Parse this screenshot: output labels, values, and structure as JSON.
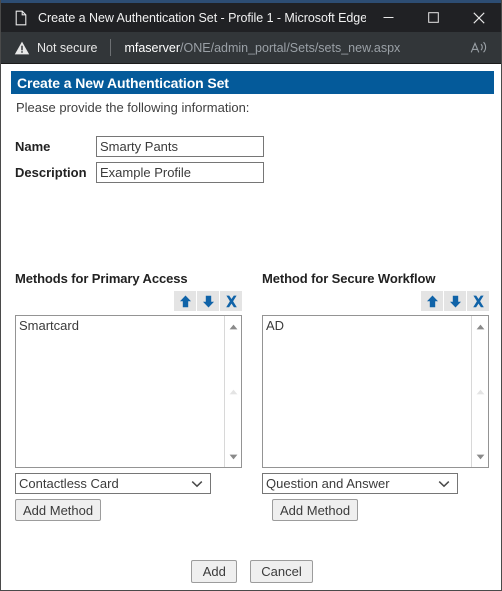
{
  "browser": {
    "title": "Create a New Authentication Set - Profile 1 - Microsoft Edge",
    "tab_icon": "document-icon",
    "window_controls": {
      "minimize": "minimize-icon",
      "maximize": "maximize-icon",
      "close": "close-icon"
    },
    "address_bar": {
      "security_icon": "warning-triangle-icon",
      "security_label": "Not secure",
      "url_host": "mfaserver",
      "url_path": "/ONE/admin_portal/Sets/sets_new.aspx",
      "read_aloud_icon": "read-aloud-icon"
    },
    "colors": {
      "titlebar_bg": "#202124",
      "addressbar_bg": "#323639",
      "accent_strip": "#2d4d73"
    }
  },
  "page": {
    "banner_title": "Create a New Authentication Set",
    "banner_color": "#045a9a",
    "intro_text": "Please provide the following information:",
    "fields": [
      {
        "label": "Name",
        "value": "Smarty Pants",
        "placeholder": ""
      },
      {
        "label": "Description",
        "value": "Example Profile",
        "placeholder": ""
      }
    ],
    "columns": [
      {
        "heading": "Methods for Primary Access",
        "icons": [
          {
            "name": "move-up-icon",
            "glyph": "up-arrow"
          },
          {
            "name": "move-down-icon",
            "glyph": "down-arrow"
          },
          {
            "name": "remove-icon",
            "glyph": "x-mark"
          }
        ],
        "list_items": [
          "Smartcard"
        ],
        "dropdown_value": "Contactless Card",
        "add_button_label": "Add Method"
      },
      {
        "heading": "Method for Secure Workflow",
        "icons": [
          {
            "name": "move-up-icon",
            "glyph": "up-arrow"
          },
          {
            "name": "move-down-icon",
            "glyph": "down-arrow"
          },
          {
            "name": "remove-icon",
            "glyph": "x-mark"
          }
        ],
        "list_items": [
          "AD"
        ],
        "dropdown_value": "Question and Answer",
        "add_button_label": "Add Method"
      }
    ],
    "footer": {
      "submit_label": "Add",
      "cancel_label": "Cancel"
    },
    "icon_accent_color": "#1063a8"
  }
}
